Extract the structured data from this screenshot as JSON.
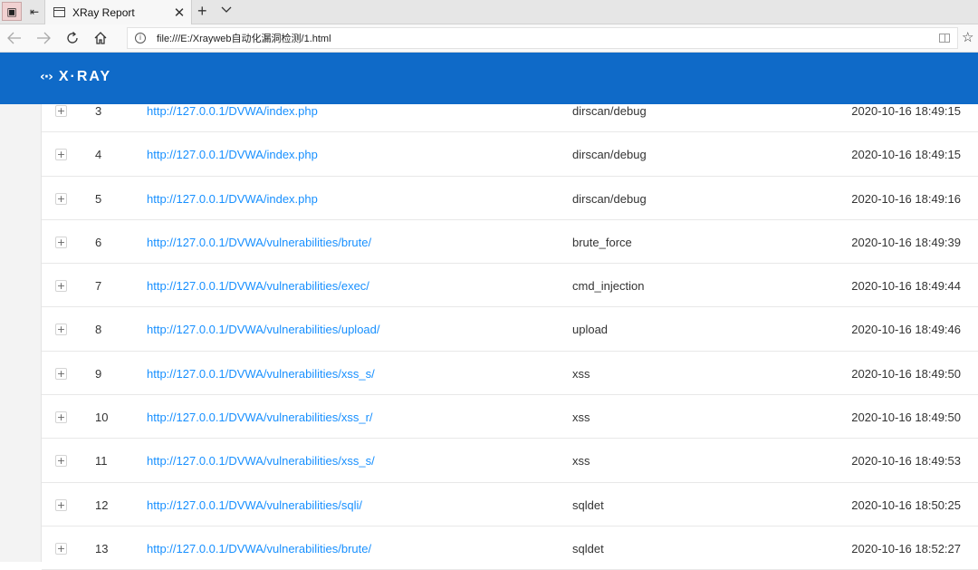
{
  "browser": {
    "tab_title": "XRay Report",
    "tab_close": "✕",
    "new_tab": "+",
    "tab_menu": "⌄",
    "url": "file:///E:/Xrayweb自动化漏洞检测/1.html",
    "info_icon": "i",
    "star": "☆",
    "icons": {
      "back": "arrow-left-icon",
      "forward": "arrow-right-icon",
      "refresh": "refresh-icon",
      "home": "home-icon"
    }
  },
  "header": {
    "logo_mark": "‹·›",
    "logo_text": "X·RAY",
    "color": "#0f6ac8"
  },
  "table": {
    "link_color": "#1890ff",
    "expand_symbol": "+",
    "rows": [
      {
        "num": "3",
        "url": "http://127.0.0.1/DVWA/index.php",
        "plugin": "dirscan/debug",
        "time": "2020-10-16 18:49:15"
      },
      {
        "num": "4",
        "url": "http://127.0.0.1/DVWA/index.php",
        "plugin": "dirscan/debug",
        "time": "2020-10-16 18:49:15"
      },
      {
        "num": "5",
        "url": "http://127.0.0.1/DVWA/index.php",
        "plugin": "dirscan/debug",
        "time": "2020-10-16 18:49:16"
      },
      {
        "num": "6",
        "url": "http://127.0.0.1/DVWA/vulnerabilities/brute/",
        "plugin": "brute_force",
        "time": "2020-10-16 18:49:39"
      },
      {
        "num": "7",
        "url": "http://127.0.0.1/DVWA/vulnerabilities/exec/",
        "plugin": "cmd_injection",
        "time": "2020-10-16 18:49:44"
      },
      {
        "num": "8",
        "url": "http://127.0.0.1/DVWA/vulnerabilities/upload/",
        "plugin": "upload",
        "time": "2020-10-16 18:49:46"
      },
      {
        "num": "9",
        "url": "http://127.0.0.1/DVWA/vulnerabilities/xss_s/",
        "plugin": "xss",
        "time": "2020-10-16 18:49:50"
      },
      {
        "num": "10",
        "url": "http://127.0.0.1/DVWA/vulnerabilities/xss_r/",
        "plugin": "xss",
        "time": "2020-10-16 18:49:50"
      },
      {
        "num": "11",
        "url": "http://127.0.0.1/DVWA/vulnerabilities/xss_s/",
        "plugin": "xss",
        "time": "2020-10-16 18:49:53"
      },
      {
        "num": "12",
        "url": "http://127.0.0.1/DVWA/vulnerabilities/sqli/",
        "plugin": "sqldet",
        "time": "2020-10-16 18:50:25"
      },
      {
        "num": "13",
        "url": "http://127.0.0.1/DVWA/vulnerabilities/brute/",
        "plugin": "sqldet",
        "time": "2020-10-16 18:52:27"
      }
    ]
  }
}
